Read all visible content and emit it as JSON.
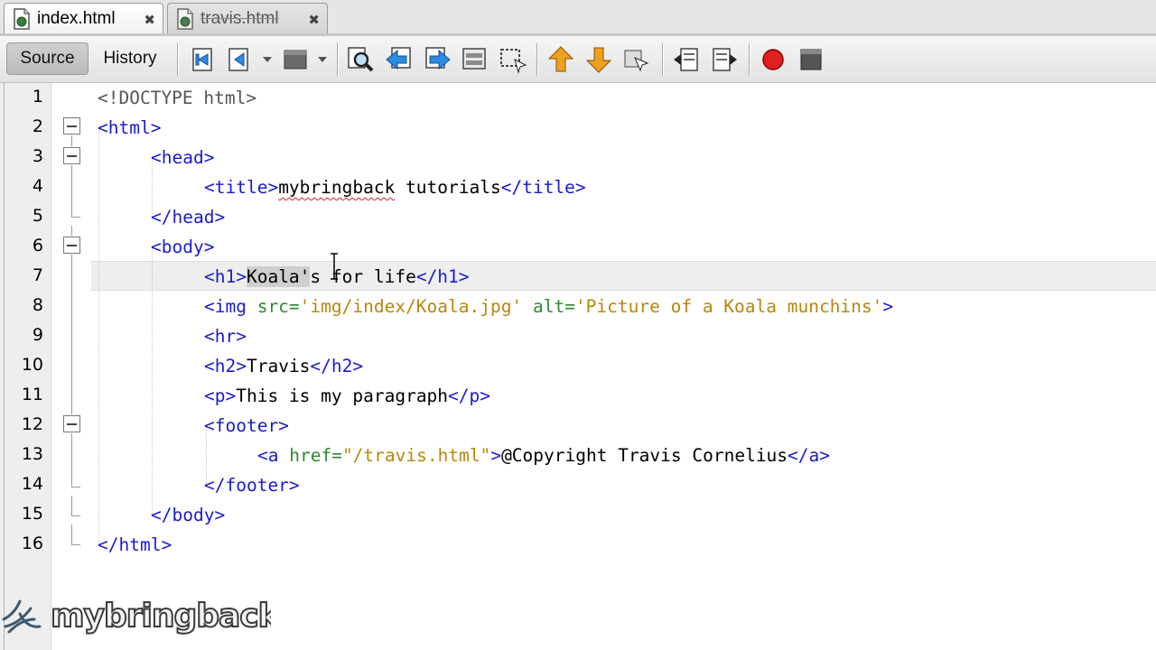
{
  "tabs": [
    {
      "label": "index.html",
      "close": "✖",
      "active": true
    },
    {
      "label": "travis.html",
      "close": "✖",
      "active": false
    }
  ],
  "toolbar": {
    "source_label": "Source",
    "history_label": "History",
    "icons": [
      "back-icon",
      "forward-dropdown-icon",
      "navigate-dropdown-icon",
      "find-icon",
      "find-previous-icon",
      "find-next-icon",
      "find-selection-icon",
      "toggle-highlight-icon",
      "previous-bookmark-icon",
      "next-bookmark-icon",
      "toggle-bookmark-icon",
      "shift-left-icon",
      "shift-right-icon",
      "record-macro-icon",
      "stop-macro-icon"
    ]
  },
  "editor": {
    "line_numbers": [
      "1",
      "2",
      "3",
      "4",
      "5",
      "6",
      "7",
      "8",
      "9",
      "10",
      "11",
      "12",
      "13",
      "14",
      "15",
      "16"
    ],
    "lines": [
      {
        "segs": [
          [
            "txt-grey",
            "<!DOCTYPE html>"
          ]
        ]
      },
      {
        "segs": [
          [
            "tag",
            "<html>"
          ]
        ]
      },
      {
        "segs": [
          [
            "tag",
            "<head>"
          ]
        ]
      },
      {
        "segs": [
          [
            "tag",
            "<title>"
          ],
          [
            "txt-squiggle",
            "mybringback"
          ],
          [
            "txt",
            " tutorials"
          ],
          [
            "tag",
            "</title>"
          ]
        ]
      },
      {
        "segs": [
          [
            "tag",
            "</head>"
          ]
        ]
      },
      {
        "segs": [
          [
            "tag",
            "<body>"
          ]
        ]
      },
      {
        "segs": [
          [
            "tag",
            "<h1>"
          ],
          [
            "txt-sel",
            "Koala'"
          ],
          [
            "txt",
            "s for life"
          ],
          [
            "tag",
            "</h1>"
          ]
        ]
      },
      {
        "segs": [
          [
            "tag",
            "<img "
          ],
          [
            "attr",
            "src="
          ],
          [
            "val",
            "'img/index/Koala.jpg'"
          ],
          [
            "txt",
            " "
          ],
          [
            "attr",
            "alt="
          ],
          [
            "val",
            "'Picture of a Koala munchins'"
          ],
          [
            "tag",
            ">"
          ]
        ]
      },
      {
        "segs": [
          [
            "tag",
            "<hr>"
          ]
        ]
      },
      {
        "segs": [
          [
            "tag",
            "<h2>"
          ],
          [
            "txt",
            "Travis"
          ],
          [
            "tag",
            "</h2>"
          ]
        ]
      },
      {
        "segs": [
          [
            "tag",
            "<p>"
          ],
          [
            "txt",
            "This is my paragraph"
          ],
          [
            "tag",
            "</p>"
          ]
        ]
      },
      {
        "segs": [
          [
            "tag",
            "<footer>"
          ]
        ]
      },
      {
        "segs": [
          [
            "tag",
            "<a "
          ],
          [
            "attr",
            "href="
          ],
          [
            "val",
            "\"/travis.html\""
          ],
          [
            "tag",
            ">"
          ],
          [
            "txt",
            "@Copyright Travis Cornelius"
          ],
          [
            "tag",
            "</a>"
          ]
        ]
      },
      {
        "segs": [
          [
            "tag",
            "</footer>"
          ]
        ]
      },
      {
        "segs": [
          [
            "tag",
            "</body>"
          ]
        ]
      },
      {
        "segs": [
          [
            "tag",
            "</html>"
          ]
        ]
      }
    ]
  },
  "watermark": {
    "text": "mybringback"
  },
  "colors": {
    "tag": "#1a1ad0",
    "attr": "#2e8a2e",
    "value": "#b8860b",
    "text": "#000000",
    "doctype": "#555555",
    "record": "#e02020"
  }
}
